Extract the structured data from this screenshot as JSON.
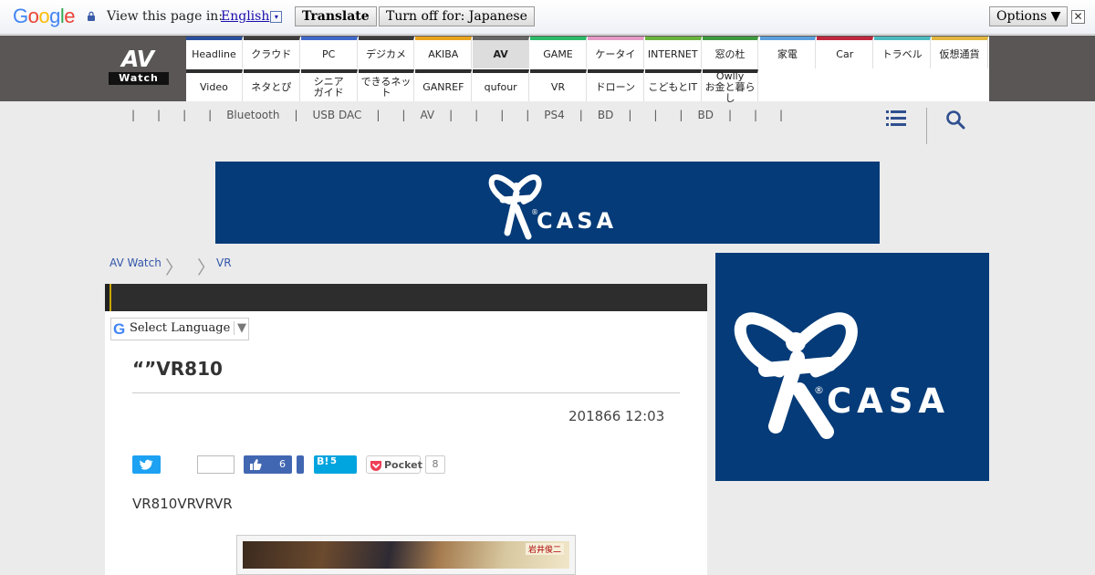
{
  "translate_bar": {
    "logo_letters": [
      {
        "ch": "G",
        "color": "#4285f4"
      },
      {
        "ch": "o",
        "color": "#ea4335"
      },
      {
        "ch": "o",
        "color": "#fbbc05"
      },
      {
        "ch": "g",
        "color": "#4285f4"
      },
      {
        "ch": "l",
        "color": "#34a853"
      },
      {
        "ch": "e",
        "color": "#ea4335"
      }
    ],
    "label": "View this page in:",
    "language": "English",
    "language_arrow": "▾",
    "translate_label": "Translate",
    "turn_off_label": "Turn off for: Japanese",
    "options_label": "Options ▼",
    "close_label": "✕"
  },
  "header": {
    "logo_top": "AV",
    "logo_bottom": "Watch",
    "nav_row1": [
      {
        "label": "Headline",
        "color": "#2a4f9c"
      },
      {
        "label": "クラウド",
        "color": "#3d3d3d"
      },
      {
        "label": "PC",
        "color": "#4169c9"
      },
      {
        "label": "デジカメ",
        "color": "#3d3d3d"
      },
      {
        "label": "AKIBA",
        "color": "#e8a31d"
      },
      {
        "label": "AV",
        "color": "#666666",
        "active": true
      },
      {
        "label": "GAME",
        "color": "#2dbb6a"
      },
      {
        "label": "ケータイ",
        "color": "#e59ac6"
      },
      {
        "label": "INTERNET",
        "color": "#6ab33d"
      },
      {
        "label": "窓の杜",
        "color": "#3f9a3f"
      },
      {
        "label": "家電",
        "color": "#5ba0dc"
      },
      {
        "label": "Car",
        "color": "#c0283d"
      },
      {
        "label": "トラベル",
        "color": "#4cbbc0"
      },
      {
        "label": "仮想通貨",
        "color": "#e1b63e"
      }
    ],
    "nav_row2": [
      {
        "label": "Video",
        "color": "#2d2d2d"
      },
      {
        "label": "ネタとぴ",
        "color": "#2d2d2d"
      },
      {
        "label": "シニア\nガイド",
        "color": "#2d2d2d"
      },
      {
        "label": "できるネット",
        "color": "#2d2d2d"
      },
      {
        "label": "GANREF",
        "color": "#2d2d2d"
      },
      {
        "label": "qufour",
        "color": "#2d2d2d"
      },
      {
        "label": "VR",
        "color": "#2d2d2d"
      },
      {
        "label": "ドローン",
        "color": "#2d2d2d"
      },
      {
        "label": "こどもとIT",
        "color": "#2d2d2d"
      },
      {
        "label": "Owlly\nお金と暮らし",
        "color": "#2d2d2d"
      }
    ]
  },
  "category_strip": {
    "items": [
      "|",
      "|",
      "|",
      "|",
      "Bluetooth",
      "|",
      "USB DAC",
      "|",
      "|",
      "AV",
      "|",
      "|",
      "|",
      "|",
      "PS4",
      "|",
      "BD",
      "|",
      "|",
      "|",
      "BD",
      "|",
      "|",
      "|"
    ]
  },
  "ads": {
    "brand": "CASA",
    "registered": "®",
    "bg_color": "#053b78"
  },
  "breadcrumb": [
    "AV Watch",
    "",
    "VR"
  ],
  "article": {
    "select_language": "Select Language",
    "select_arrow": "▼",
    "google_g": "G",
    "title": "“”VR810",
    "date": "201866 12:03",
    "lead": "VR810VRVRVR",
    "social": {
      "facebook_count": "6",
      "hatena_label": "B!",
      "hatena_count": "5",
      "pocket_label": "Pocket",
      "pocket_count": "8"
    },
    "image_tag": "岩井俊二"
  }
}
